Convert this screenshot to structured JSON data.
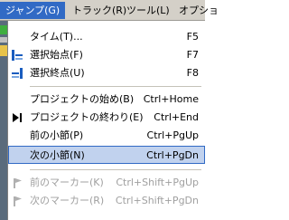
{
  "menubar": {
    "items": [
      {
        "label": "ジャンプ(G)"
      },
      {
        "label": "トラック(R)"
      },
      {
        "label": "ツール(L)"
      },
      {
        "label": "オプショ"
      }
    ]
  },
  "menu": {
    "items": [
      {
        "label": "タイム(T)...",
        "shortcut": "F5"
      },
      {
        "label": "選択始点(F)",
        "shortcut": "F7"
      },
      {
        "label": "選択終点(U)",
        "shortcut": "F8"
      },
      {
        "label": "プロジェクトの始め(B)",
        "shortcut": "Ctrl+Home"
      },
      {
        "label": "プロジェクトの終わり(E)",
        "shortcut": "Ctrl+End"
      },
      {
        "label": "前の小節(P)",
        "shortcut": "Ctrl+PgUp"
      },
      {
        "label": "次の小節(N)",
        "shortcut": "Ctrl+PgDn"
      },
      {
        "label": "前のマーカー(K)",
        "shortcut": "Ctrl+Shift+PgUp"
      },
      {
        "label": "次のマーカー(R)",
        "shortcut": "Ctrl+Shift+PgDn"
      }
    ]
  },
  "colors": {
    "highlight_bg": "#c1d2ee",
    "highlight_border": "#316ac5",
    "disabled_text": "#a0a0a0",
    "menubar_bg": "#d4d0c8"
  }
}
